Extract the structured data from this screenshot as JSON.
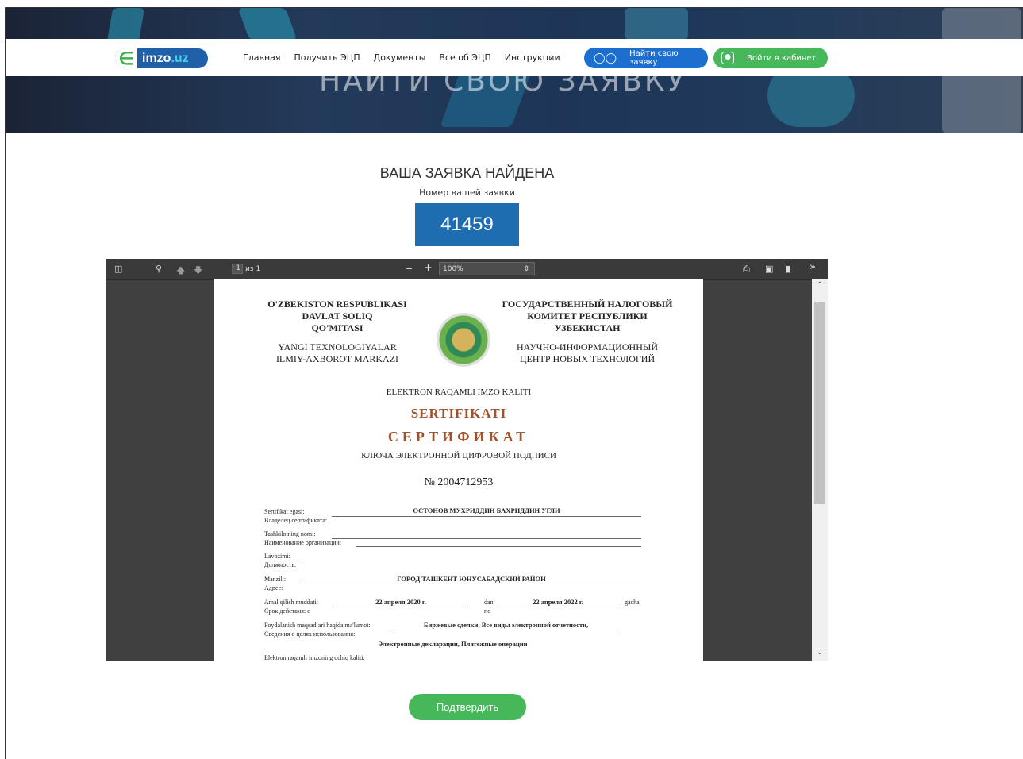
{
  "hero": {
    "ghost_text": "НАЙТИ СВОЮ ЗАЯВКУ"
  },
  "header": {
    "logo": {
      "prefix": "imzo",
      "suffix": ".uz"
    },
    "nav": [
      "Главная",
      "Получить ЭЦП",
      "Документы",
      "Все об ЭЦП",
      "Инструкции"
    ],
    "find_button": "Найти свою заявку",
    "login_button": "Войти в кабинет"
  },
  "result": {
    "title": "ВАША ЗАЯВКА НАЙДЕНА",
    "subtitle": "Номер вашей заявки",
    "number": "41459"
  },
  "viewer": {
    "page_current": "1",
    "page_total": "из 1",
    "zoom": "100%"
  },
  "certificate": {
    "left_header": [
      "O'ZBEKISTON RESPUBLIKASI",
      "DAVLAT SOLIQ",
      "QO'MITASI"
    ],
    "left_sub": [
      "YANGI TEXNOLOGIYALAR",
      "ILMIY-AXBOROT MARKAZI"
    ],
    "right_header": [
      "ГОСУДАРСТВЕННЫЙ НАЛОГОВЫЙ",
      "КОМИТЕТ РЕСПУБЛИКИ",
      "УЗБЕКИСТАН"
    ],
    "right_sub": [
      "НАУЧНО-ИНФОРМАЦИОННЫЙ",
      "ЦЕНТР НОВЫХ ТЕХНОЛОГИЙ"
    ],
    "line1": "ELEKTRON RAQAMLI IMZO KALITI",
    "title_uz": "SERTIFIKATI",
    "title_ru": "СЕРТИФИКАТ",
    "line2": "КЛЮЧА ЭЛЕКТРОННОЙ ЦИФРОВОЙ ПОДПИСИ",
    "cert_no": "№ 2004712953",
    "fields": {
      "owner_label_uz": "Sertifikat egasi:",
      "owner_label_ru": "Владелец сертификата:",
      "owner_value": "ОСТОНОВ МУХРИДДИН БАХРИДДИН УГЛИ",
      "org_label_uz": "Tashkilotning nomi:",
      "org_label_ru": "Наименование организации:",
      "pos_label_uz": "Lavozimi:",
      "pos_label_ru": "Должность:",
      "addr_label_uz": "Manzili:",
      "addr_label_ru": "Адрес:",
      "addr_value": "ГОРОД ТАШКЕНТ ЮНУСАБАДСКИЙ РАЙОН",
      "valid_label_uz": "Amal qilish muddati:",
      "valid_label_ru": "Срок действия: с",
      "valid_from": "22 апреля 2020 г.",
      "dan": "dan",
      "po": "по",
      "valid_to": "22 апреля 2022 г.",
      "gacha": "gacha",
      "purpose_label_uz": "Foydalanish maqsadlari haqida ma'lumot:",
      "purpose_label_ru": "Сведения о целях использования:",
      "purpose_value1": "Биржевые сделки, Все виды электронной отчетности,",
      "purpose_value2": "Электронные декларации, Платежные операции",
      "cut_line": "Elektron raqamli imzoning ochiq kaliti:"
    }
  },
  "confirm_button": "Подтвердить"
}
